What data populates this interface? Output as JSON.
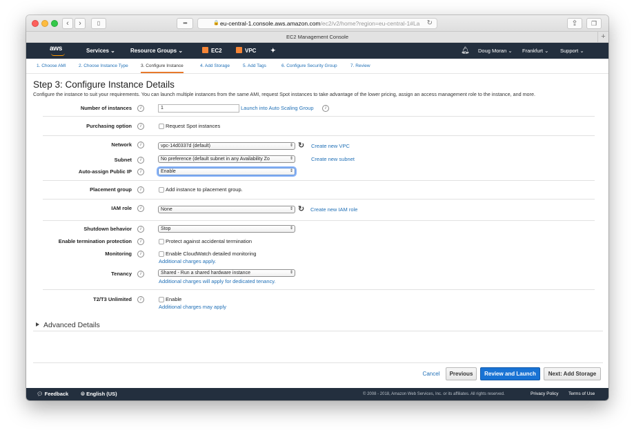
{
  "browser": {
    "url_host": "eu-central-1.console.aws.amazon.com",
    "url_path": "/ec2/v2/home?region=eu-central-1#La",
    "tab_title": "EC2 Management Console"
  },
  "nav": {
    "logo": "aws",
    "services": "Services",
    "resource_groups": "Resource Groups",
    "ec2": "EC2",
    "vpc": "VPC",
    "user": "Doug Moran",
    "region": "Frankfurt",
    "support": "Support"
  },
  "steps": [
    "1. Choose AMI",
    "2. Choose Instance Type",
    "3. Configure Instance",
    "4. Add Storage",
    "5. Add Tags",
    "6. Configure Security Group",
    "7. Review"
  ],
  "page": {
    "title": "Step 3: Configure Instance Details",
    "description": "Configure the instance to suit your requirements. You can launch multiple instances from the same AMI, request Spot instances to take advantage of the lower pricing, assign an access management role to the instance, and more."
  },
  "form": {
    "num_instances": {
      "label": "Number of instances",
      "value": "1",
      "link": "Launch into Auto Scaling Group"
    },
    "purchasing": {
      "label": "Purchasing option",
      "checkbox": "Request Spot instances"
    },
    "network": {
      "label": "Network",
      "value": "vpc-14d0337d (default)",
      "link": "Create new VPC"
    },
    "subnet": {
      "label": "Subnet",
      "value": "No preference (default subnet in any Availability Zo",
      "link": "Create new subnet"
    },
    "public_ip": {
      "label": "Auto-assign Public IP",
      "value": "Enable"
    },
    "placement": {
      "label": "Placement group",
      "checkbox": "Add instance to placement group."
    },
    "iam": {
      "label": "IAM role",
      "value": "None",
      "link": "Create new IAM role"
    },
    "shutdown": {
      "label": "Shutdown behavior",
      "value": "Stop"
    },
    "termination": {
      "label": "Enable termination protection",
      "checkbox": "Protect against accidental termination"
    },
    "monitoring": {
      "label": "Monitoring",
      "checkbox": "Enable CloudWatch detailed monitoring",
      "note": "Additional charges apply."
    },
    "tenancy": {
      "label": "Tenancy",
      "value": "Shared - Run a shared hardware instance",
      "note": "Additional charges will apply for dedicated tenancy."
    },
    "unlimited": {
      "label": "T2/T3 Unlimited",
      "checkbox": "Enable",
      "note": "Additional charges may apply"
    }
  },
  "advanced": "Advanced Details",
  "buttons": {
    "cancel": "Cancel",
    "previous": "Previous",
    "review": "Review and Launch",
    "next": "Next: Add Storage"
  },
  "footer": {
    "feedback": "Feedback",
    "language": "English (US)",
    "copyright": "© 2008 - 2018, Amazon Web Services, Inc. or its affiliates. All rights reserved.",
    "privacy": "Privacy Policy",
    "terms": "Terms of Use"
  },
  "colors": {
    "nav_bg": "#232f3e",
    "link": "#1f6fb6",
    "primary": "#1973d4",
    "active_tab": "#e7792c"
  }
}
